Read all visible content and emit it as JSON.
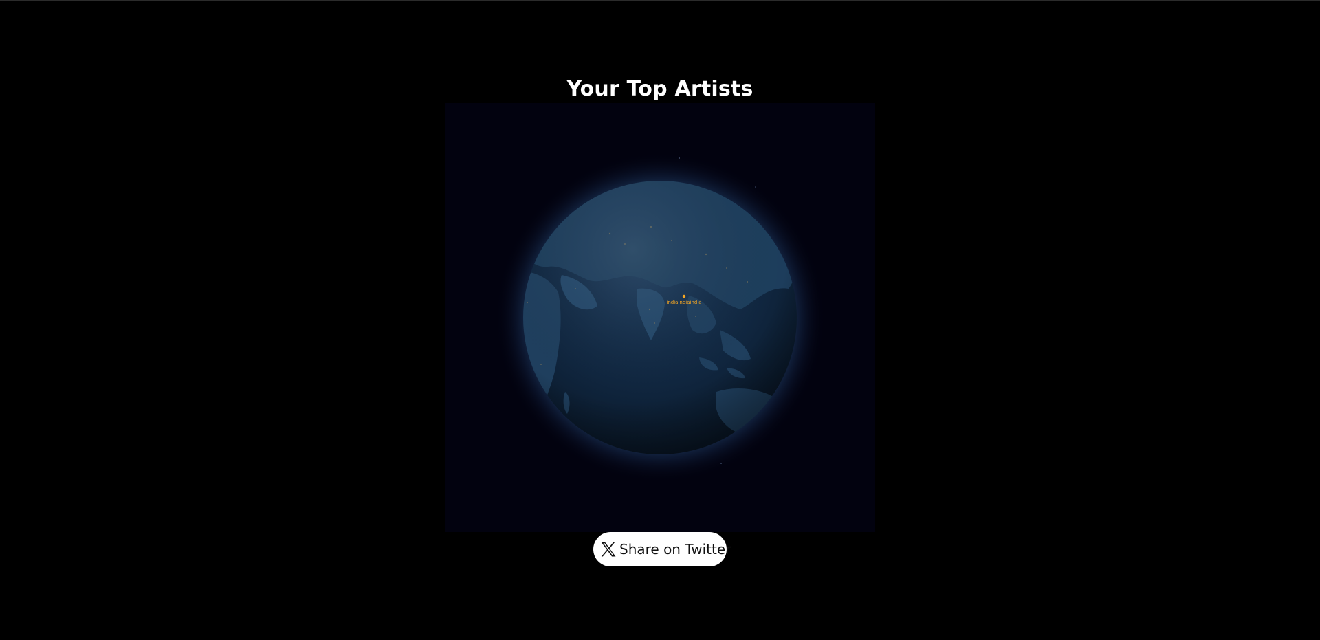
{
  "page": {
    "title": "Your Top Artists"
  },
  "globe": {
    "background_color": "#02020f",
    "ocean_color": "#10263f",
    "land_color": "#1f3f5e",
    "atmosphere_color": "#2e5a8f",
    "marker_color": "#f5a623",
    "marker_label": "indiaindiaindia"
  },
  "share": {
    "label": "Share on Twitter",
    "icon": "x-logo-icon"
  }
}
